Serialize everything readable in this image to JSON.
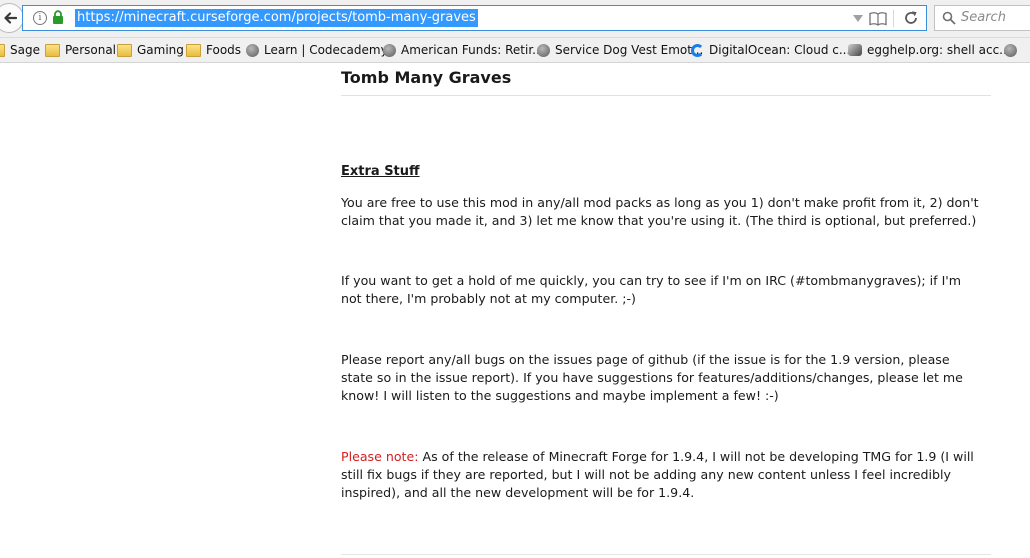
{
  "browser": {
    "url": "https://minecraft.curseforge.com/projects/tomb-many-graves",
    "search_placeholder": "Search"
  },
  "bookmarks": [
    {
      "label": "Sage",
      "icon": "folder-icon"
    },
    {
      "label": "Personal",
      "icon": "folder-icon"
    },
    {
      "label": "Gaming",
      "icon": "folder-icon"
    },
    {
      "label": "Foods",
      "icon": "folder-icon"
    },
    {
      "label": "Learn | Codecademy",
      "icon": "globe-icon"
    },
    {
      "label": "American Funds: Retir...",
      "icon": "globe-icon"
    },
    {
      "label": "Service Dog Vest Emot...",
      "icon": "globe-icon"
    },
    {
      "label": "DigitalOcean: Cloud c...",
      "icon": "digitalocean-icon"
    },
    {
      "label": "egghelp.org: shell acc...",
      "icon": "egghelp-icon"
    }
  ],
  "page": {
    "title": "Tomb Many Graves",
    "section_heading": "Extra Stuff",
    "paragraphs": {
      "p1": "You are free to use this mod in any/all mod packs as long as you 1) don't make profit from it, 2) don't claim that you made it, and 3) let me know that you're using it. (The third is optional, but preferred.)",
      "p2": "If you want to get a hold of me quickly, you can try to see if I'm on IRC (#tombmanygraves); if I'm not there, I'm probably not at my computer. ;-)",
      "p3": "Please report any/all bugs on the issues page of github (if the issue is for the 1.9 version, please state so in the issue report). If you have suggestions for features/additions/changes, please let me know! I will listen to the suggestions and maybe implement a few! :-)"
    },
    "note": {
      "label": "Please note:",
      "text": " As of the release of Minecraft Forge for 1.9.4, I will not be developing TMG for 1.9 (I will still fix bugs if they are reported, but I will not be adding any new content unless I feel incredibly inspired), and all the new development will be for 1.9.4."
    }
  },
  "colors": {
    "url_highlight": "#3399ff",
    "note_label": "#d31f1f",
    "lock_green": "#2a9a2a"
  }
}
